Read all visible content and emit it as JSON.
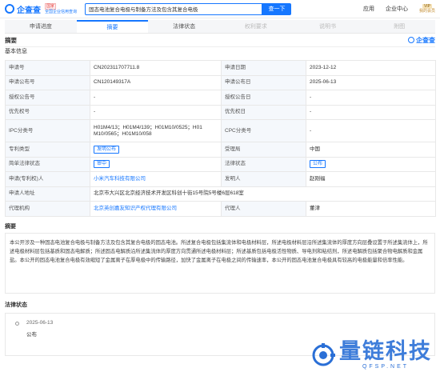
{
  "header": {
    "logo_text": "企查查",
    "logo_tag": "国家",
    "logo_sub": "全国企业信用查询",
    "search_value": "固态电池复合电极与制备方法及包含其复合电极",
    "search_button": "查一下",
    "menu_app": "应用",
    "menu_enterprise": "企业中心",
    "vip_badge": "VIP",
    "vip_label": "我的会员"
  },
  "tabs": [
    {
      "label": "申请进度",
      "state": "normal"
    },
    {
      "label": "摘要",
      "state": "active"
    },
    {
      "label": "法律状态",
      "state": "normal"
    },
    {
      "label": "权利要求",
      "state": "disabled"
    },
    {
      "label": "说明书",
      "state": "disabled"
    },
    {
      "label": "附图",
      "state": "disabled"
    }
  ],
  "section_title": "摘要",
  "brand_small": "企查查",
  "basic_info_title": "基本信息",
  "info": {
    "application_no_label": "申请号",
    "application_no": "CN202311707711.8",
    "application_date_label": "申请日期",
    "application_date": "2023-12-12",
    "publication_no_label": "申请公布号",
    "publication_no": "CN120149317A",
    "publication_date_label": "申请公布日",
    "publication_date": "2025-06-13",
    "grant_no_label": "授权公告号",
    "grant_no": "-",
    "grant_date_label": "授权公告日",
    "grant_date": "-",
    "priority_no_label": "优先权号",
    "priority_no": "-",
    "priority_date_label": "优先权日",
    "priority_date": "-",
    "ipc_label": "IPC分类号",
    "ipc_line1": "H01M4/13；H01M4/139；H01M10/0525；H01",
    "ipc_line2": "M10/0565；H01M10/058",
    "cpc_label": "CPC分类号",
    "cpc": "-",
    "patent_type_label": "专利类型",
    "patent_type": "发明公布",
    "country_label": "受理局",
    "country": "中国",
    "legal_status_label": "简单法律状态",
    "legal_status": "审中",
    "status_label": "法律状态",
    "status": "公布",
    "applicant_label": "申请(专利权)人",
    "applicant": "小米汽车科技有限公司",
    "inventor_label": "发明人",
    "inventor": "赵刚福",
    "address_label": "申请人地址",
    "address": "北京市大兴区北京经济技术开发区科创十街15号院5号楼6层618室",
    "agency_label": "代理机构",
    "agency": "北京英创嘉友知识产权代理有限公司",
    "agent_label": "代理人",
    "agent": "董津"
  },
  "abstract_title": "摘要",
  "abstract_text": "本公开涉及一种固态电池复合电极与制备方法及包含其复合电极的固态电池。所述复合电极包括集流体和电极材料层，所述电极材料层沿所述集流体的厚度方向层叠设置于所述集流体上，所述电极材料层包括基质和固态电解质；所述固态电解质沿所述集流体的厚度方向贯通所述电极材料层；所述基质包括电极活性物质、导电剂和粘结剂，所述电解质包括聚合物电解质和金属盐。本公开的固态电池复合电极有效缩短了金属离子在厚电极中的传输路径，加快了金属离子在电极之间的传输速率，本公开的固态电池复合电极具有较高的电极能量和倍率性能。",
  "legal_title": "法律状态",
  "legal_events": [
    {
      "date": "2025-06-13",
      "status": "公布"
    }
  ],
  "watermark": {
    "main": "量链科技",
    "sub": "QFSP.NET"
  },
  "colors": {
    "accent": "#1677ff",
    "watermark": "#2a6fd6"
  }
}
